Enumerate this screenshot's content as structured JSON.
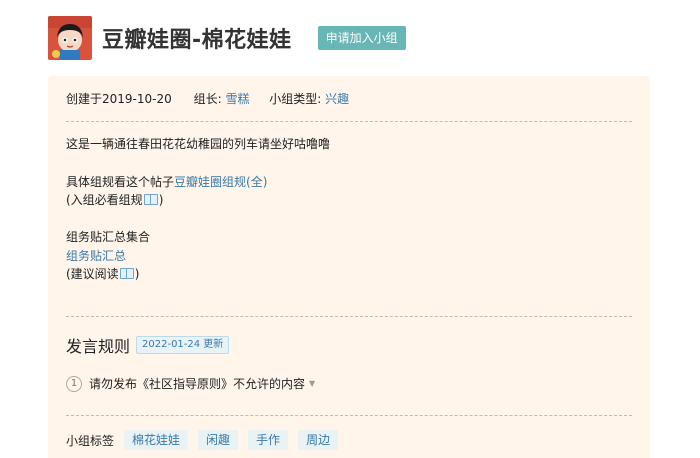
{
  "group": {
    "title": "豆瓣娃圈-棉花娃娃",
    "join_label": "申请加入小组"
  },
  "meta": {
    "created": "创建于2019-10-20",
    "leader_label": "组长:",
    "leader_name": "雪糕",
    "type_label": "小组类型:",
    "type_value": "兴趣"
  },
  "intro": {
    "line1": "这是一辆通往春田花花幼稚园的列车请坐好咕噜噜",
    "line2_prefix": "具体组规看这个帖子",
    "line2_link": "豆瓣娃圈组规(全)",
    "line3_prefix": "(入组必看组规",
    "line3_suffix": ")",
    "line4": "组务贴汇总集合",
    "line5_link": "组务贴汇总",
    "line6_prefix": "(建议阅读",
    "line6_suffix": ")"
  },
  "rules": {
    "title": "发言规则",
    "date_badge": "2022-01-24 更新",
    "items": [
      {
        "num": "1",
        "text": "请勿发布《社区指导原则》不允许的内容"
      }
    ]
  },
  "tags": {
    "label": "小组标签",
    "items": [
      "棉花娃娃",
      "闲趣",
      "手作",
      "周边"
    ]
  },
  "colors": {
    "join_button": "#68b6b5",
    "panel_bg": "#fff5ea",
    "link": "#3a7aa8"
  }
}
